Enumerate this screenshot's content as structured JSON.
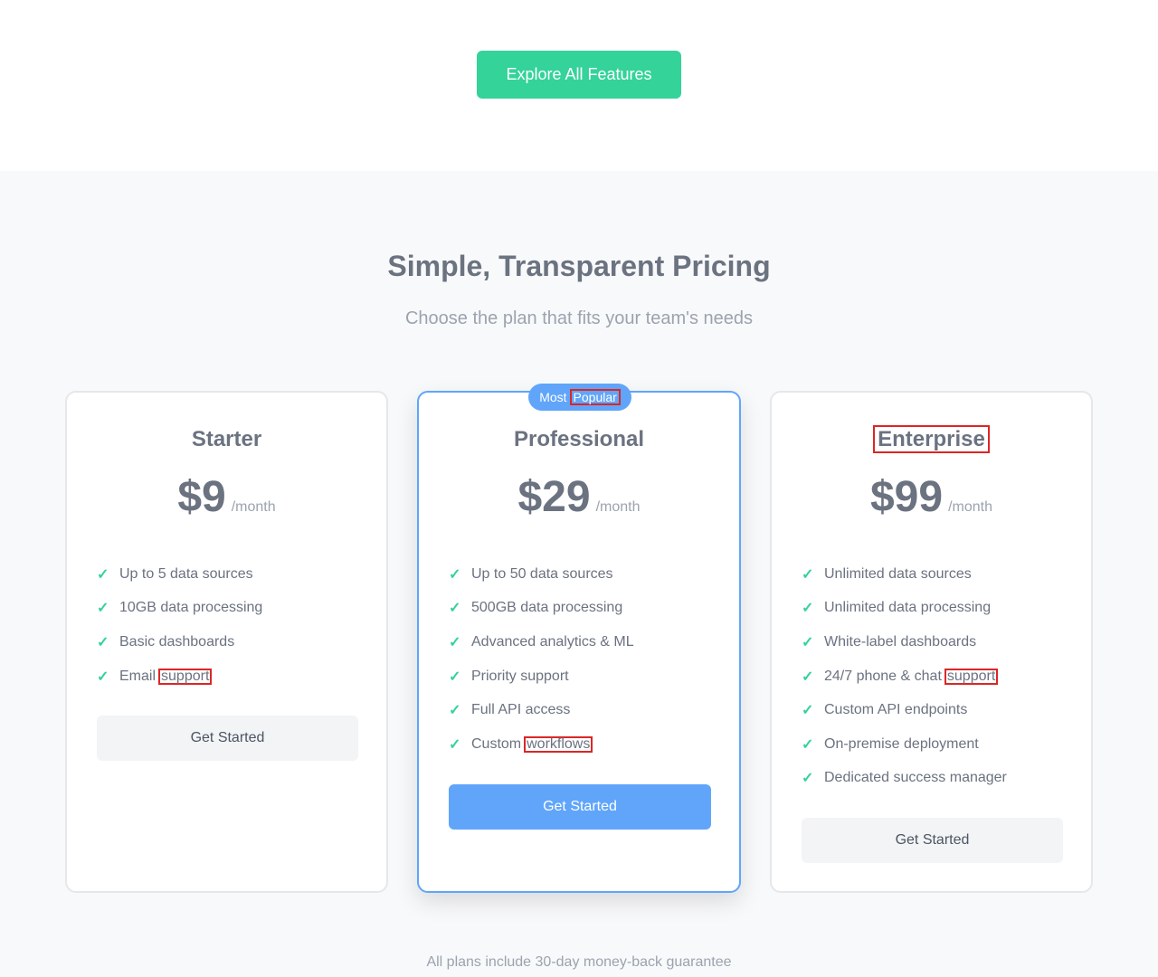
{
  "hero": {
    "explore_label": "Explore All Features"
  },
  "pricing": {
    "title": "Simple, Transparent Pricing",
    "subtitle": "Choose the plan that fits your team's needs",
    "guarantee": "All plans include 30-day money-back guarantee",
    "plans": [
      {
        "name": "Starter",
        "price": "$9",
        "period": "/month",
        "features": [
          "Up to 5 data sources",
          "10GB data processing",
          "Basic dashboards",
          "Email",
          "support"
        ],
        "cta": "Get Started"
      },
      {
        "badge_a": "Most",
        "badge_b": "Popular",
        "name": "Professional",
        "price": "$29",
        "period": "/month",
        "features": [
          "Up to 50 data sources",
          "500GB data processing",
          "Advanced analytics & ML",
          "Priority support",
          "Full API access",
          "Custom",
          "workflows"
        ],
        "cta": "Get Started"
      },
      {
        "name": "Enterprise",
        "price": "$99",
        "period": "/month",
        "features": [
          "Unlimited data sources",
          "Unlimited data processing",
          "White-label dashboards",
          "24/7 phone & chat",
          "support",
          "Custom API endpoints",
          "On-premise deployment",
          "Dedicated success manager"
        ],
        "cta": "Get Started"
      }
    ]
  },
  "colors": {
    "accent_green": "#34d399",
    "accent_blue": "#60a5fa",
    "highlight": "#dc2626"
  },
  "icons": {
    "feature": "check-icon"
  }
}
